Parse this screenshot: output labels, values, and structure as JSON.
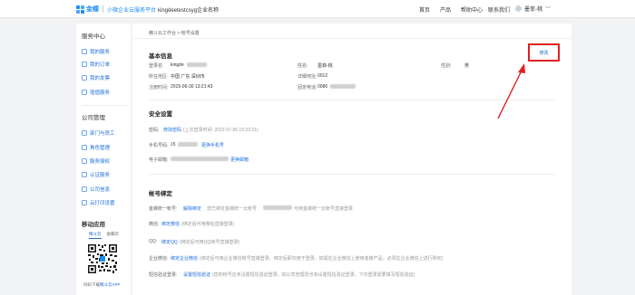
{
  "header": {
    "logo_text": "金蝶",
    "logo_sub": "小微企业云服务平台",
    "org_name": "kingdeetestcsyg企业名称",
    "nav": [
      "首页",
      "产品",
      "帮助中心",
      "联系我们"
    ],
    "user_name": "墨菲-桃"
  },
  "sidebar": {
    "service_title": "服务中心",
    "service_items": [
      "我的服务",
      "我的订单",
      "我的发票",
      "增值服务"
    ],
    "company_title": "公司管理",
    "company_items": [
      "部门与员工",
      "角色管理",
      "服务授权",
      "认证服务",
      "公司信息",
      "云打印设置"
    ],
    "mobile_title": "移动应用",
    "app_tabs": [
      "精斗云",
      "金蝶云"
    ],
    "download_prefix": "扫码下载",
    "download_link": "精斗云APP"
  },
  "breadcrumb": "精斗云工作台 > 帐号设置",
  "basic": {
    "title": "基本信息",
    "edit_label": "修改",
    "login_label": "登录名:",
    "login_value": "kingde",
    "name_label": "姓名:",
    "name_value": "墨菲-桃",
    "gender_label": "性别:",
    "gender_value": "男",
    "region_label": "所在地区:",
    "region_value": "中国 广东 深圳市",
    "address_label": "详细地址:",
    "address_value": "0012",
    "regtime_label": "注册时间:",
    "regtime_value": "2015-06-30 13:21:43",
    "phone_label": "固定电话:",
    "phone_value": "0086"
  },
  "security": {
    "title": "安全设置",
    "password_label": "密码:",
    "password_link": "修改密码",
    "password_note": "(上次登录时间: 2022-07-05 10:23:31)",
    "mobile_label": "手机号码:",
    "mobile_value": "15",
    "mobile_link": "更换手机号",
    "email_label": "电子邮箱:",
    "email_link": "更换邮箱"
  },
  "binding": {
    "title": "帐号绑定",
    "kingdee_label": "金蝶统一帐号:",
    "kingdee_link": "解除绑定",
    "kingdee_note": "您已绑定金蝶统一云帐号",
    "kingdee_note2": "可用金蝶统一云帐号直接登录",
    "wechat_label": "微信:",
    "wechat_link": "绑定微信",
    "wechat_note": "(绑定后可用微信直接登录)",
    "qq_label": "QQ:",
    "qq_link": "绑定QQ",
    "qq_note": "(绑定后可用QQ帐号直接登录)",
    "enterprise_label": "企业微信:",
    "enterprise_link": "绑定企业微信",
    "enterprise_note": "(绑定后可用企业微信帐号直接登录，绑定后即仅用于登录，如需在企业微信上使用金蝶产品，必须在企业微信上进行购买)",
    "sms_label": "短信验证登录:",
    "sms_link": "设置短信验证",
    "sms_note": "(您的帐号还未设置短信验证登录，如公司管理员也有设置短信验证登录，下次登录需要填写短信验证)"
  }
}
